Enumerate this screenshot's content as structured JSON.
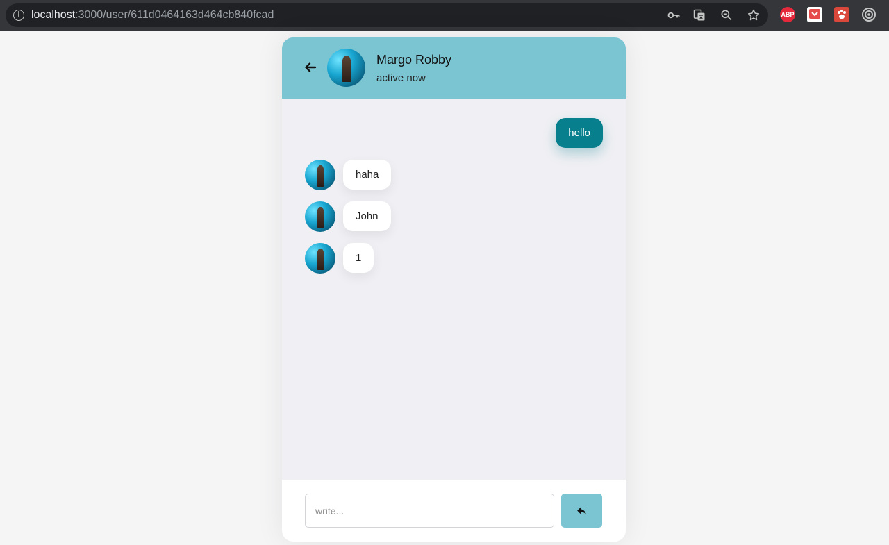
{
  "browser": {
    "url_host": "localhost",
    "url_path": ":3000/user/611d0464163d464cb840fcad",
    "extensions": [
      {
        "name": "adblock-plus-icon",
        "label": "ABP",
        "color": "#e6283c"
      },
      {
        "name": "pocket-icon",
        "label": "",
        "color": "#ffffff"
      },
      {
        "name": "extension-paw-icon",
        "label": "",
        "color": "#d9483b"
      }
    ]
  },
  "chat": {
    "contact_name": "Margo Robby",
    "contact_status": "active now",
    "messages": [
      {
        "direction": "out",
        "text": "hello"
      },
      {
        "direction": "in",
        "text": "haha"
      },
      {
        "direction": "in",
        "text": "John"
      },
      {
        "direction": "in",
        "text": "1"
      }
    ],
    "input_placeholder": "write...",
    "input_value": ""
  },
  "colors": {
    "header": "#7bc5d3",
    "outgoing_bubble": "#087f8c",
    "send_button": "#7bc5d3"
  }
}
